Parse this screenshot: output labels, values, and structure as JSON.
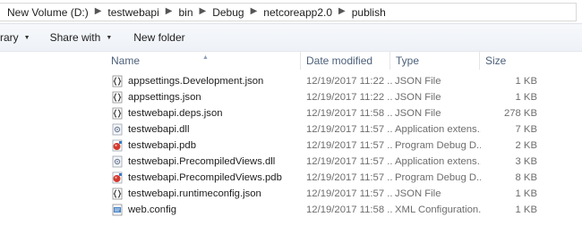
{
  "address": {
    "crumbs": [
      "New Volume (D:)",
      "testwebapi",
      "bin",
      "Debug",
      "netcoreapp2.0",
      "publish"
    ]
  },
  "toolbar": {
    "library_label": "rary",
    "share_label": "Share with",
    "new_folder_label": "New folder"
  },
  "columns": {
    "name": "Name",
    "date": "Date modified",
    "type": "Type",
    "size": "Size"
  },
  "files": [
    {
      "name": "appsettings.Development.json",
      "date": "12/19/2017 11:22 ...",
      "type": "JSON File",
      "size": "1 KB",
      "icon": "json-file-icon"
    },
    {
      "name": "appsettings.json",
      "date": "12/19/2017 11:22 ...",
      "type": "JSON File",
      "size": "1 KB",
      "icon": "json-file-icon"
    },
    {
      "name": "testwebapi.deps.json",
      "date": "12/19/2017 11:58 ...",
      "type": "JSON File",
      "size": "278 KB",
      "icon": "json-file-icon"
    },
    {
      "name": "testwebapi.dll",
      "date": "12/19/2017 11:57 ...",
      "type": "Application extens...",
      "size": "7 KB",
      "icon": "dll-file-icon"
    },
    {
      "name": "testwebapi.pdb",
      "date": "12/19/2017 11:57 ...",
      "type": "Program Debug D...",
      "size": "2 KB",
      "icon": "pdb-file-icon"
    },
    {
      "name": "testwebapi.PrecompiledViews.dll",
      "date": "12/19/2017 11:57 ...",
      "type": "Application extens...",
      "size": "3 KB",
      "icon": "dll-file-icon"
    },
    {
      "name": "testwebapi.PrecompiledViews.pdb",
      "date": "12/19/2017 11:57 ...",
      "type": "Program Debug D...",
      "size": "8 KB",
      "icon": "pdb-file-icon"
    },
    {
      "name": "testwebapi.runtimeconfig.json",
      "date": "12/19/2017 11:57 ...",
      "type": "JSON File",
      "size": "1 KB",
      "icon": "json-file-icon"
    },
    {
      "name": "web.config",
      "date": "12/19/2017 11:58 ...",
      "type": "XML Configuration...",
      "size": "1 KB",
      "icon": "config-file-icon"
    }
  ]
}
